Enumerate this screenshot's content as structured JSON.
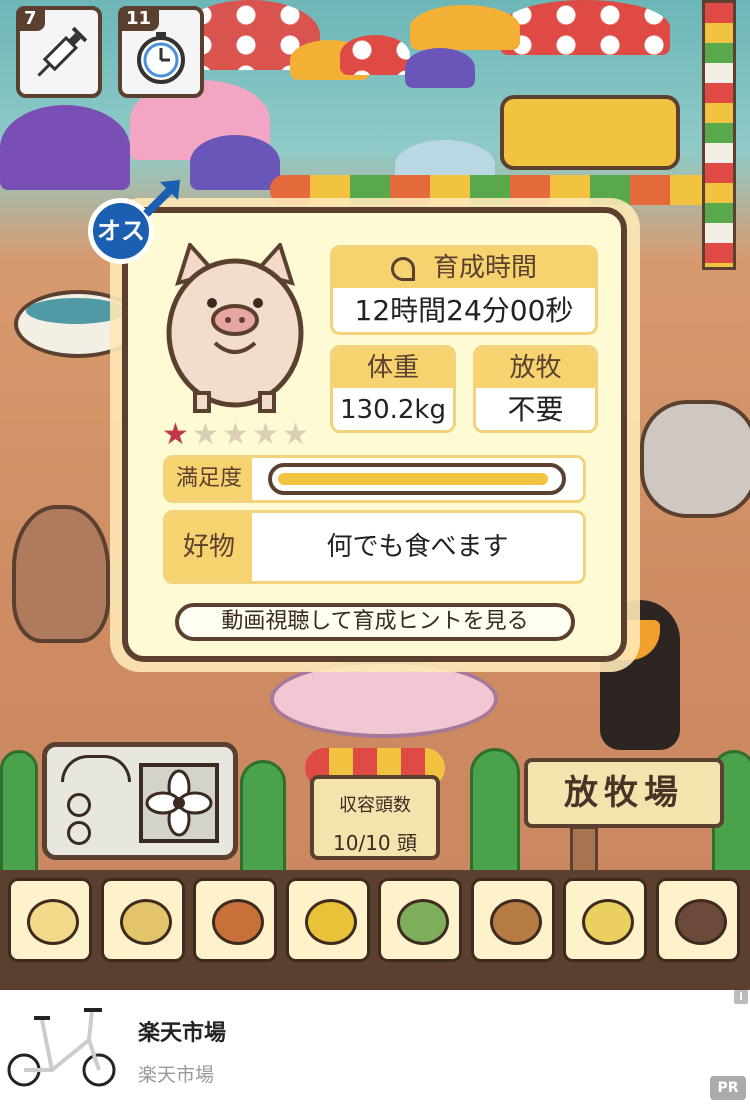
{
  "top_items": [
    {
      "count": "7",
      "icon": "syringe-icon"
    },
    {
      "count": "11",
      "icon": "stopwatch-icon"
    }
  ],
  "gender_badge": "オス",
  "stats": {
    "time_label": "育成時間",
    "time_value": "12時間24分00秒",
    "weight_label": "体重",
    "weight_value": "130.2kg",
    "graze_label": "放牧",
    "graze_value": "不要",
    "satisfaction_label": "満足度",
    "satisfaction_level": 0.97,
    "favorite_label": "好物",
    "favorite_value": "何でも食べます",
    "hint_button": "動画視聴して育成ヒントを見る",
    "rating": 1,
    "rating_max": 5
  },
  "capacity": {
    "label": "収容頭数",
    "value": "10/10 頭"
  },
  "pasture_sign": "放牧場",
  "feeds": [
    "beans-feed-icon",
    "mixed-beans-feed-icon",
    "sweet-potato-feed-icon",
    "corn-feed-icon",
    "leaf-nuts-feed-icon",
    "acorn-feed-icon",
    "grain-bowl-feed-icon",
    "chestnut-plate-feed-icon"
  ],
  "ad": {
    "title": "楽天市場",
    "subtitle": "楽天市場",
    "badge": "PR",
    "info": "i"
  },
  "colors": {
    "panel_border": "#5b4030",
    "accent": "#f7d36f",
    "gender": "#1a5fb0",
    "star_on": "#c0394a",
    "star_off": "#d9cfb5"
  }
}
